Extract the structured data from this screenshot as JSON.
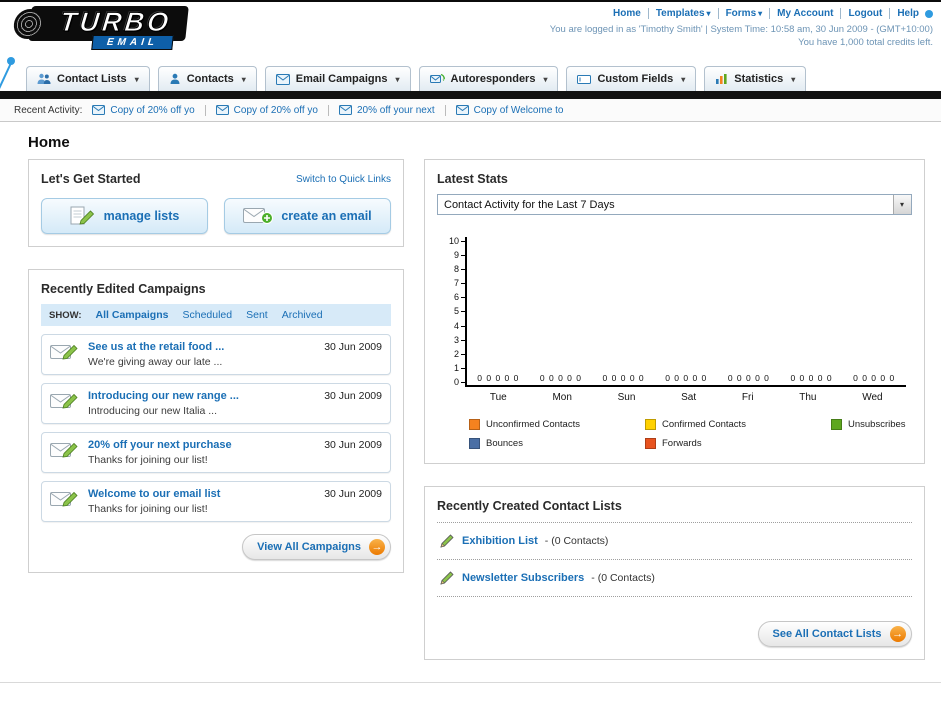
{
  "ui": {
    "colors": {
      "link_blue": "#1b6fb5",
      "nav_black": "#121212",
      "accent_orange": "#ec7a00",
      "panel_border": "#cfcfcf",
      "filter_bar_bg": "#d7eaf8"
    },
    "icons": {
      "chevron_down": "▾",
      "arrow_right": "→"
    }
  },
  "header": {
    "logo_primary": "TURBO",
    "logo_secondary": "EMAIL",
    "links": [
      {
        "label": "Home"
      },
      {
        "label": "Templates",
        "dropdown": true
      },
      {
        "label": "Forms",
        "dropdown": true
      },
      {
        "label": "My Account"
      },
      {
        "label": "Logout"
      },
      {
        "label": "Help"
      }
    ],
    "session_line": "You are logged in as 'Timothy Smith' | System Time: 10:58 am, 30 Jun 2009 - (GMT+10:00)",
    "credits_line": "You have 1,000 total credits left."
  },
  "nav": {
    "tabs": [
      {
        "label": "Contact Lists"
      },
      {
        "label": "Contacts"
      },
      {
        "label": "Email Campaigns"
      },
      {
        "label": "Autoresponders"
      },
      {
        "label": "Custom Fields"
      },
      {
        "label": "Statistics"
      }
    ]
  },
  "recent_activity": {
    "label": "Recent Activity:",
    "items": [
      {
        "label": "Copy of 20% off yo"
      },
      {
        "label": "Copy of 20% off yo"
      },
      {
        "label": "20% off your next"
      },
      {
        "label": "Copy of Welcome to"
      }
    ]
  },
  "page_title": "Home",
  "get_started": {
    "title": "Let's Get Started",
    "switch_link": "Switch to Quick Links",
    "manage_lists_label": "manage lists",
    "create_email_label": "create an email"
  },
  "campaigns": {
    "title": "Recently Edited Campaigns",
    "show_label": "SHOW:",
    "filters": [
      {
        "label": "All Campaigns",
        "active": true
      },
      {
        "label": "Scheduled"
      },
      {
        "label": "Sent"
      },
      {
        "label": "Archived"
      }
    ],
    "items": [
      {
        "title": "See us at the retail food ...",
        "subtitle": "We're giving away our late ...",
        "date": "30 Jun 2009"
      },
      {
        "title": "Introducing our new range ...",
        "subtitle": "Introducing our new Italia ...",
        "date": "30 Jun 2009"
      },
      {
        "title": "20% off your next purchase",
        "subtitle": "Thanks for joining our list!",
        "date": "30 Jun 2009"
      },
      {
        "title": "Welcome to our email list",
        "subtitle": "Thanks for joining our list!",
        "date": "30 Jun 2009"
      }
    ],
    "view_all_label": "View All Campaigns"
  },
  "latest_stats": {
    "title": "Latest Stats",
    "dropdown_value": "Contact Activity for the Last 7 Days"
  },
  "chart_data": {
    "type": "bar",
    "title": "Contact Activity for the Last 7 Days",
    "categories": [
      "Tue",
      "Mon",
      "Sun",
      "Sat",
      "Fri",
      "Thu",
      "Wed"
    ],
    "series": [
      {
        "name": "Unconfirmed Contacts",
        "color": "#f5821f",
        "values": [
          0,
          0,
          0,
          0,
          0,
          0,
          0
        ]
      },
      {
        "name": "Confirmed Contacts",
        "color": "#ffd100",
        "values": [
          0,
          0,
          0,
          0,
          0,
          0,
          0
        ]
      },
      {
        "name": "Unsubscribes",
        "color": "#5ea71f",
        "values": [
          0,
          0,
          0,
          0,
          0,
          0,
          0
        ]
      },
      {
        "name": "Bounces",
        "color": "#4a6fa5",
        "values": [
          0,
          0,
          0,
          0,
          0,
          0,
          0
        ]
      },
      {
        "name": "Forwards",
        "color": "#e8531f",
        "values": [
          0,
          0,
          0,
          0,
          0,
          0,
          0
        ]
      }
    ],
    "ylim": [
      0,
      10
    ],
    "yticks": [
      0,
      1,
      2,
      3,
      4,
      5,
      6,
      7,
      8,
      9,
      10
    ],
    "xlabel": "",
    "ylabel": "",
    "grid": false,
    "legend_position": "bottom"
  },
  "contact_lists": {
    "title": "Recently Created Contact Lists",
    "items": [
      {
        "name": "Exhibition List",
        "suffix": "- (0 Contacts)"
      },
      {
        "name": "Newsletter Subscribers",
        "suffix": "- (0 Contacts)"
      }
    ],
    "see_all_label": "See All Contact Lists"
  }
}
